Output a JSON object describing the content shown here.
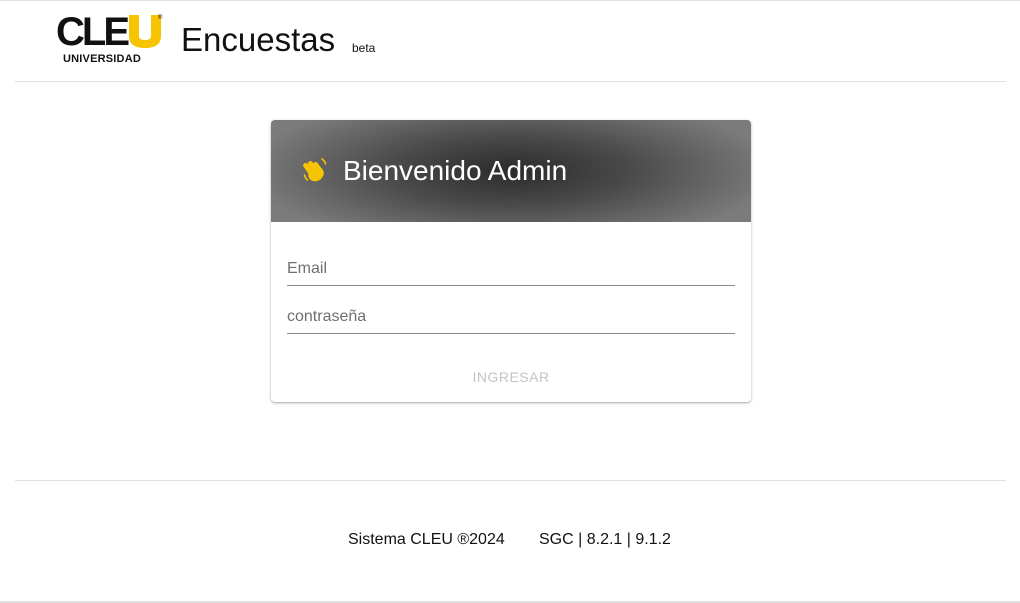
{
  "header": {
    "logo": {
      "word": "CLE",
      "letter_u": "U",
      "registered": "®",
      "subtitle": "UNIVERSIDAD",
      "accent_color": "#f6c400"
    },
    "app_title": "Encuestas",
    "app_tag": "beta"
  },
  "login_card": {
    "icon": "waving-hand-icon",
    "title": "Bienvenido Admin",
    "email_placeholder": "Email",
    "password_placeholder": "contraseña",
    "submit_label": "INGRESAR",
    "header_color": "#4a4a4a"
  },
  "footer": {
    "copyright": "Sistema CLEU ®2024",
    "version": "SGC | 8.2.1 | 9.1.2"
  }
}
